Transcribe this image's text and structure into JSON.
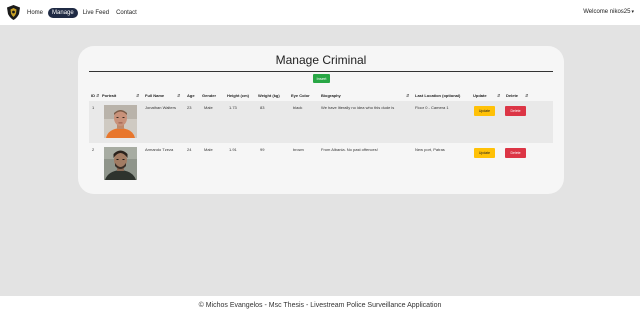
{
  "nav": {
    "links": [
      "Home",
      "Manage",
      "Live Feed",
      "Contact"
    ],
    "welcome": "Welcome nikos25"
  },
  "page": {
    "title": "Manage Criminal",
    "insert_label": "Insert"
  },
  "table": {
    "headers": [
      "ID",
      "Portrait",
      "Full Name",
      "Age",
      "Gender",
      "Height (cm)",
      "Weight (kg)",
      "Eye Color",
      "Biography",
      "Last Location (optional)",
      "Update",
      "Delete"
    ],
    "rows": [
      {
        "id": "1",
        "name": "Jonathan Walters",
        "age": "23",
        "gender": "Male",
        "height": "1.73",
        "weight": "83",
        "eye": "black",
        "bio": "We have literally no idea who this dude is",
        "location": "Floor 0 - Camera 1",
        "update": "Update",
        "delete": "Delete"
      },
      {
        "id": "2",
        "name": "Armando Tzeza",
        "age": "24",
        "gender": "Male",
        "height": "1.91",
        "weight": "99",
        "eye": "brown",
        "bio": "From Albania. No past offences!",
        "location": "New port, Patras",
        "update": "Update",
        "delete": "Delete"
      }
    ]
  },
  "footer": {
    "text": "© Michos Evangelos - Msc Thesis - Livestream Police Surveillance Application"
  },
  "colors": {
    "nav_active": "#1f2a44",
    "insert": "#28a745",
    "update": "#ffc107",
    "delete": "#dc3545"
  }
}
